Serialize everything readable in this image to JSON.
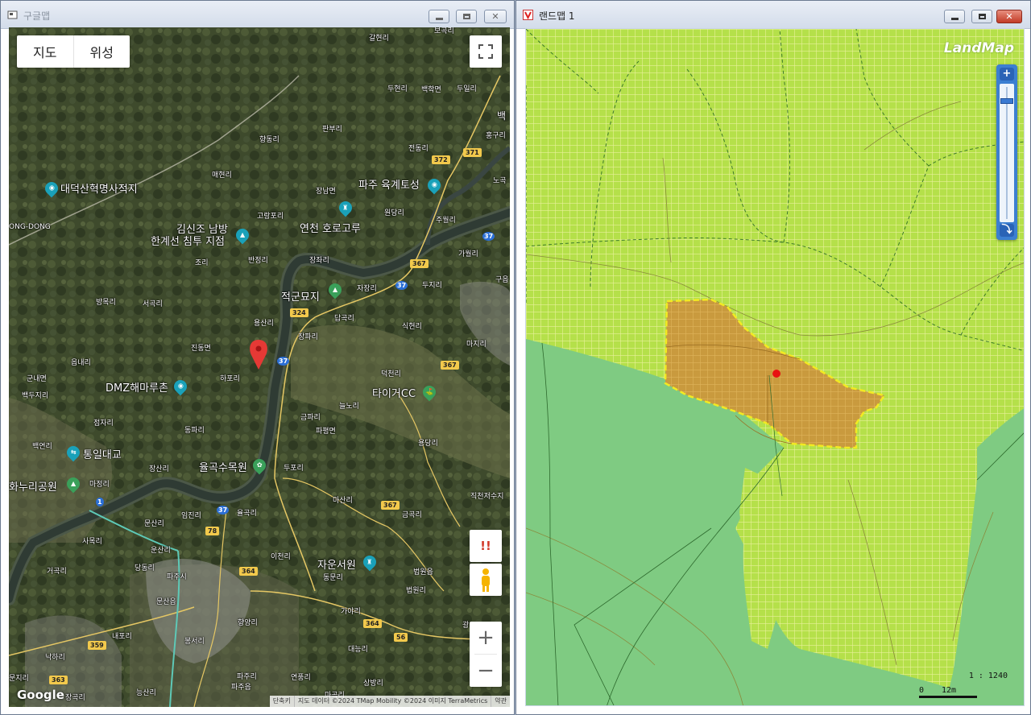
{
  "left_window": {
    "title": "구글맵",
    "controls": {
      "minimize": "minimize",
      "maximize": "maximize",
      "close": "✕"
    },
    "map_type": {
      "map": "지도",
      "satellite": "위성"
    },
    "warning_button": "!!",
    "zoom": {
      "in": "+",
      "out": "−"
    },
    "logo": "Google",
    "footer": [
      "단축키",
      "지도 데이터 ©2024 TMap Mobility ©2024 이미지 TerraMetrics",
      "약관"
    ],
    "labels": {
      "l1": "갈현리",
      "l2": "두현리",
      "l3": "백학면",
      "l4": "두일리",
      "l5": "판부리",
      "l6": "향동리",
      "l7": "전동리",
      "l8": "매현리",
      "l9": "대덕산혁명사적지",
      "l10": "파주 육계토성",
      "l11": "장남면",
      "l12": "원당리",
      "l13": "고랑포리",
      "l14": "연천 호로고루",
      "l15": "김신조 남방",
      "l16": "한계선 침투 지점",
      "l17": "ONG-DONG",
      "l18": "반정리",
      "l19": "장좌리",
      "l20": "조리",
      "l21": "자장리",
      "l22": "적군묘지",
      "l23": "방목리",
      "l24": "서곡리",
      "l25": "용산리",
      "l26": "답곡리",
      "l27": "식현리",
      "l28": "장파리",
      "l29": "진동면",
      "l30": "읍내리",
      "l31": "군내면",
      "l32": "하포리",
      "l33": "DMZ해마루촌",
      "l34": "덕천리",
      "l35": "타이거CC",
      "l36": "늘노리",
      "l37": "금파리",
      "l38": "파평면",
      "l39": "점자리",
      "l40": "동파리",
      "l41": "백연리",
      "l42": "통일대교",
      "l43": "장산리",
      "l44": "율곡수목원",
      "l45": "두포리",
      "l46": "마정리",
      "l47": "화누리공원",
      "l48": "용당리",
      "l49": "마산리",
      "l50": "임진리",
      "l51": "율곡리",
      "l52": "문산리",
      "l53": "사목리",
      "l54": "운산리",
      "l55": "이천리",
      "l56": "자운서원",
      "l57": "금곡리",
      "l58": "거곡리",
      "l59": "당동리",
      "l60": "파주시",
      "l61": "동문리",
      "l62": "법원읍",
      "l63": "문산읍",
      "l64": "법원리",
      "l65": "향양리",
      "l66": "가야리",
      "l67": "내포리",
      "l68": "봉서리",
      "l69": "대능리",
      "l70": "파주리",
      "l71": "파주읍",
      "l72": "연풍리",
      "l73": "상방리",
      "l74": "능산리",
      "l75": "낙하리",
      "l76": "문지리",
      "l77": "백",
      "l78": "홍구리",
      "l79": "노곡",
      "l80": "주월리",
      "l81": "가월리",
      "l82": "구읍",
      "l83": "두지리",
      "l84": "마지리",
      "l85": "직천저수지",
      "l86": "마곡리",
      "l87": "광",
      "l88": "보곡리",
      "l89": "백두지리",
      "l90": "장곡리"
    },
    "roads": {
      "r1": "372",
      "r2": "371",
      "r3": "37",
      "r4": "367",
      "r5": "37",
      "r6": "324",
      "r7": "37",
      "r8": "367",
      "r9": "1",
      "r10": "37",
      "r11": "367",
      "r12": "78",
      "r13": "364",
      "r14": "364",
      "r15": "56",
      "r16": "359",
      "r17": "363"
    }
  },
  "right_window": {
    "title": "랜드맵 1",
    "controls": {
      "minimize": "minimize",
      "maximize": "maximize",
      "close": "✕"
    },
    "logo": "LandMap",
    "zoom": {
      "in": "+",
      "out": "⤵"
    },
    "scale": {
      "ratio": "1 : 1240",
      "zero": "0",
      "distance": "12m"
    },
    "colors": {
      "grid_fill": "#b5e04a",
      "grid_line": "#e8f19a",
      "forest": "#7fcb82",
      "parcel": "#c99a3e",
      "parcel_outline": "#f2ea22",
      "marker": "#e81111"
    }
  }
}
